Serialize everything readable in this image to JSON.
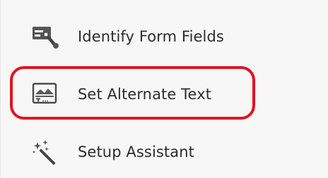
{
  "tools": {
    "items": [
      {
        "label": "Identify Form Fields",
        "icon": "identify-form-fields-icon"
      },
      {
        "label": "Set Alternate Text",
        "icon": "alternate-text-icon"
      },
      {
        "label": "Setup Assistant",
        "icon": "setup-assistant-icon"
      }
    ],
    "highlighted_index": 1,
    "highlight_color": "#e0141e",
    "icon_color": "#4a4a4a",
    "text_color": "#2c2c2c"
  }
}
